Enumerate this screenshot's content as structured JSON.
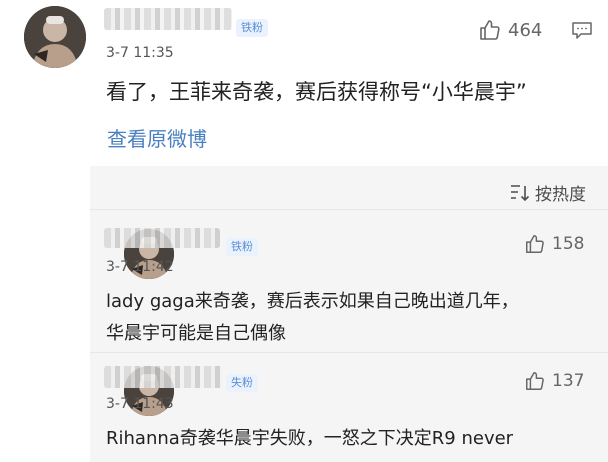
{
  "top_comment": {
    "badge": "铁粉",
    "time": "3-7 11:35",
    "likes": "464",
    "text": "看了，王菲来奇袭，赛后获得称号“小华晨宇”",
    "view_original": "查看原微博"
  },
  "replies": {
    "sort_label": "按热度",
    "items": [
      {
        "badge": "铁粉",
        "time": "3-7 11:42",
        "likes": "158",
        "text_line1": "lady gaga来奇袭，赛后表示如果自己晚出道几年，",
        "text_line2": "华晨宇可能是自己偶像"
      },
      {
        "badge": "失粉",
        "time": "3-7 11:43",
        "likes": "137",
        "text_line1": "Rihanna奇袭华晨宇失败，一怒之下决定R9 never"
      }
    ]
  }
}
